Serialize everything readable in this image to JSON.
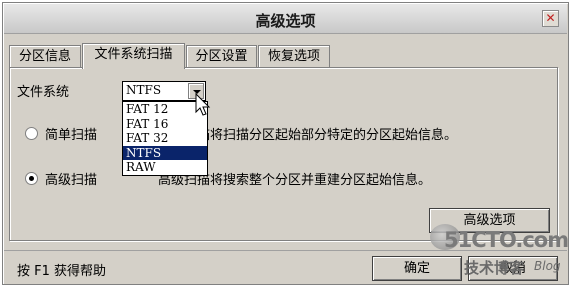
{
  "window": {
    "title": "高级选项",
    "close_glyph": "✕"
  },
  "tabs": [
    {
      "label": "分区信息",
      "active": false
    },
    {
      "label": "文件系统扫描",
      "active": true
    },
    {
      "label": "分区设置",
      "active": false
    },
    {
      "label": "恢复选项",
      "active": false
    }
  ],
  "filesystem": {
    "label": "文件系统",
    "selected": "NTFS",
    "options": [
      "FAT 12",
      "FAT 16",
      "FAT 32",
      "NTFS",
      "RAW"
    ]
  },
  "scan_modes": [
    {
      "label": "简单扫描",
      "description": "简单扫描将扫描分区起始部分特定的分区起始信息。",
      "checked": false
    },
    {
      "label": "高级扫描",
      "description": "高级扫描将搜索整个分区并重建分区起始信息。",
      "checked": true
    }
  ],
  "buttons": {
    "advanced": "高级选项",
    "ok": "确定",
    "cancel": "取消"
  },
  "status": {
    "help": "按 F1 获得帮助"
  },
  "watermark": {
    "brand": "51CTO.com",
    "sub": "技术博客",
    "blog": "Blog"
  }
}
